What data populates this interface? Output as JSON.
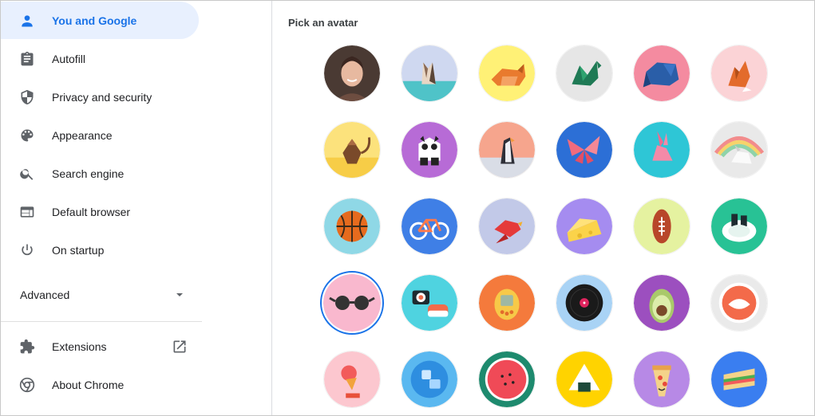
{
  "sidebar": {
    "items": [
      {
        "label": "You and Google",
        "icon": "person-icon",
        "active": true
      },
      {
        "label": "Autofill",
        "icon": "clipboard-icon"
      },
      {
        "label": "Privacy and security",
        "icon": "shield-icon"
      },
      {
        "label": "Appearance",
        "icon": "palette-icon"
      },
      {
        "label": "Search engine",
        "icon": "search-icon"
      },
      {
        "label": "Default browser",
        "icon": "browser-window-icon"
      },
      {
        "label": "On startup",
        "icon": "power-icon"
      }
    ],
    "advanced_label": "Advanced",
    "extensions_label": "Extensions",
    "about_label": "About Chrome"
  },
  "main": {
    "title": "Pick an avatar",
    "selected_avatar": "sunglasses",
    "avatars": [
      [
        "user-photo",
        "origami-cat",
        "origami-corgi",
        "origami-dragon",
        "origami-elephant",
        "origami-fox"
      ],
      [
        "origami-monkey",
        "origami-panda",
        "origami-penguin",
        "origami-butterfly",
        "origami-rabbit",
        "origami-unicorn"
      ],
      [
        "basketball",
        "bicycle",
        "bird",
        "cheese",
        "football",
        "sushi-plate"
      ],
      [
        "sunglasses",
        "sushi-rolls",
        "tamagotchi",
        "vinyl-record",
        "avocado",
        "smiley"
      ],
      [
        "ice-cream",
        "ice-cubes",
        "watermelon",
        "onigiri",
        "pizza",
        "sandwich"
      ]
    ]
  },
  "colors": {
    "accent": "#1a73e8",
    "active_bg": "#e8f0fe",
    "text": "#202124"
  }
}
